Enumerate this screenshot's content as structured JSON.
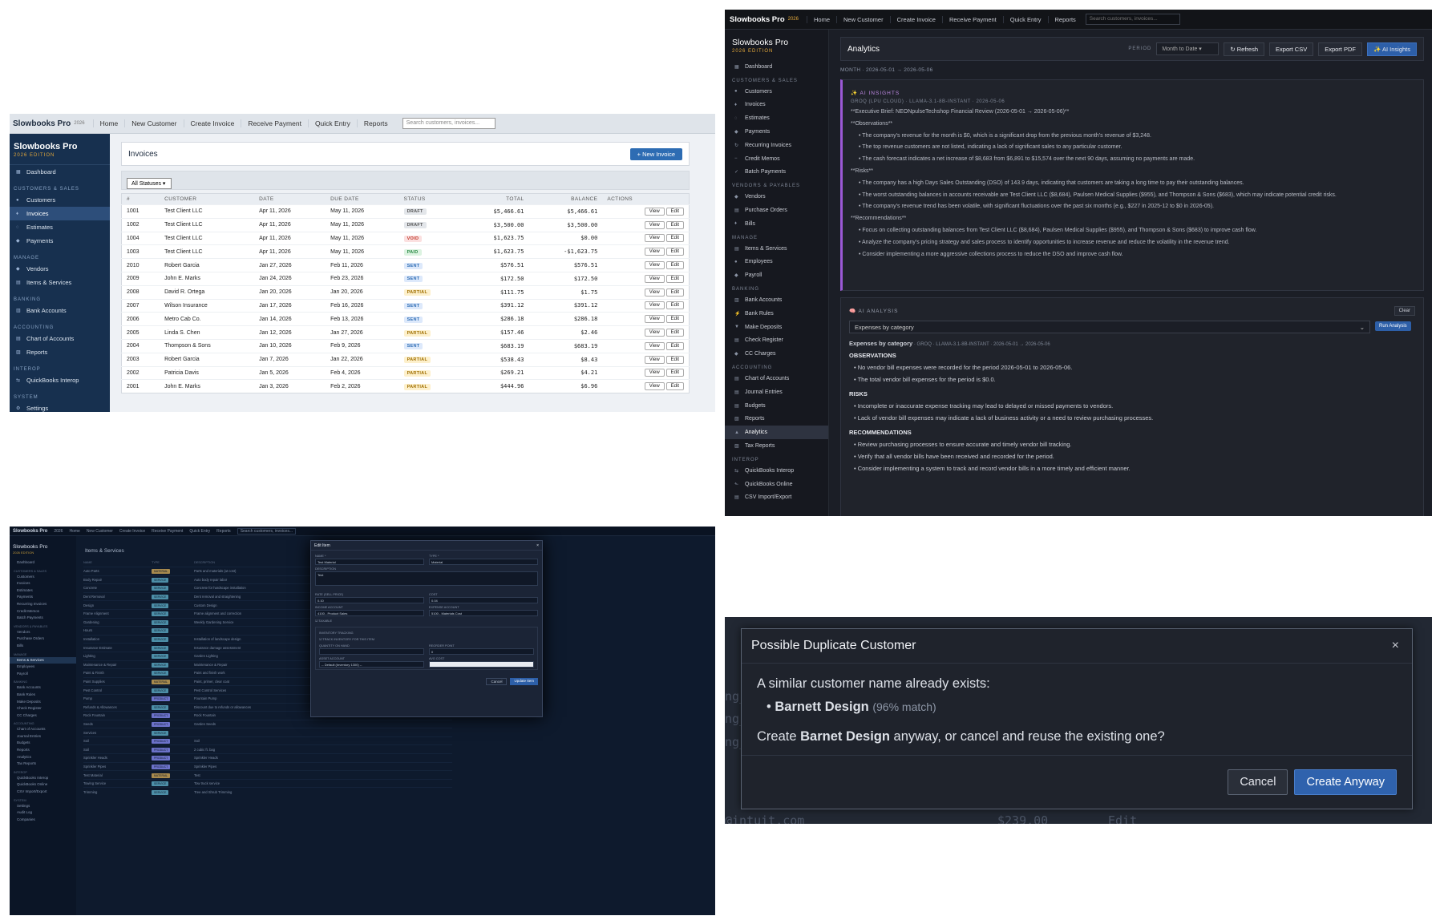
{
  "p1": {
    "brand": "Slowbooks Pro",
    "brand_year": "2026",
    "nav": [
      "Home",
      "New Customer",
      "Create Invoice",
      "Receive Payment",
      "Quick Entry",
      "Reports"
    ],
    "search_placeholder": "Search customers, invoices...",
    "sidebar_title": "Slowbooks Pro",
    "sidebar_edition": "2026 EDITION",
    "sidebar": [
      {
        "section": "",
        "items": [
          {
            "label": "Dashboard",
            "icon": "▦"
          }
        ]
      },
      {
        "section": "CUSTOMERS & SALES",
        "items": [
          {
            "label": "Customers",
            "icon": "●"
          },
          {
            "label": "Invoices",
            "icon": "♦",
            "active": true
          },
          {
            "label": "Estimates",
            "icon": "◌"
          },
          {
            "label": "Payments",
            "icon": "◆"
          }
        ]
      },
      {
        "section": "MANAGE",
        "items": [
          {
            "label": "Vendors",
            "icon": "◆"
          },
          {
            "label": "Items & Services",
            "icon": "▤"
          }
        ]
      },
      {
        "section": "BANKING",
        "items": [
          {
            "label": "Bank Accounts",
            "icon": "▥"
          }
        ]
      },
      {
        "section": "ACCOUNTING",
        "items": [
          {
            "label": "Chart of Accounts",
            "icon": "▤"
          },
          {
            "label": "Reports",
            "icon": "▨"
          }
        ]
      },
      {
        "section": "INTEROP",
        "items": [
          {
            "label": "QuickBooks Interop",
            "icon": "⇆"
          }
        ]
      },
      {
        "section": "SYSTEM",
        "items": [
          {
            "label": "Settings",
            "icon": "⚙"
          }
        ]
      }
    ],
    "page_title": "Invoices",
    "new_button": "+ New Invoice",
    "filter": "All Statuses",
    "columns": [
      "#",
      "CUSTOMER",
      "DATE",
      "DUE DATE",
      "STATUS",
      "TOTAL",
      "BALANCE",
      "ACTIONS"
    ],
    "view_label": "View",
    "edit_label": "Edit",
    "rows": [
      [
        "1001",
        "Test Client LLC",
        "Apr 11, 2026",
        "May 11, 2026",
        "DRAFT",
        "$5,466.61",
        "$5,466.61"
      ],
      [
        "1002",
        "Test Client LLC",
        "Apr 11, 2026",
        "May 11, 2026",
        "DRAFT",
        "$3,500.00",
        "$3,500.00"
      ],
      [
        "1004",
        "Test Client LLC",
        "Apr 11, 2026",
        "May 11, 2026",
        "VOID",
        "$1,623.75",
        "$0.00"
      ],
      [
        "1003",
        "Test Client LLC",
        "Apr 11, 2026",
        "May 11, 2026",
        "PAID",
        "$1,623.75",
        "-$1,623.75"
      ],
      [
        "2010",
        "Robert Garcia",
        "Jan 27, 2026",
        "Feb 11, 2026",
        "SENT",
        "$576.51",
        "$576.51"
      ],
      [
        "2009",
        "John E. Marks",
        "Jan 24, 2026",
        "Feb 23, 2026",
        "SENT",
        "$172.50",
        "$172.50"
      ],
      [
        "2008",
        "David R. Ortega",
        "Jan 20, 2026",
        "Jan 20, 2026",
        "PARTIAL",
        "$111.75",
        "$1.75"
      ],
      [
        "2007",
        "Wilson Insurance",
        "Jan 17, 2026",
        "Feb 16, 2026",
        "SENT",
        "$391.12",
        "$391.12"
      ],
      [
        "2006",
        "Metro Cab Co.",
        "Jan 14, 2026",
        "Feb 13, 2026",
        "SENT",
        "$286.18",
        "$286.18"
      ],
      [
        "2005",
        "Linda S. Chen",
        "Jan 12, 2026",
        "Jan 27, 2026",
        "PARTIAL",
        "$157.46",
        "$2.46"
      ],
      [
        "2004",
        "Thompson & Sons",
        "Jan 10, 2026",
        "Feb 9, 2026",
        "SENT",
        "$683.19",
        "$683.19"
      ],
      [
        "2003",
        "Robert Garcia",
        "Jan 7, 2026",
        "Jan 22, 2026",
        "PARTIAL",
        "$538.43",
        "$8.43"
      ],
      [
        "2002",
        "Patricia Davis",
        "Jan 5, 2026",
        "Feb 4, 2026",
        "PARTIAL",
        "$269.21",
        "$4.21"
      ],
      [
        "2001",
        "John E. Marks",
        "Jan 3, 2026",
        "Feb 2, 2026",
        "PARTIAL",
        "$444.96",
        "$6.96"
      ]
    ]
  },
  "p2": {
    "brand": "Slowbooks Pro",
    "brand_year": "2026",
    "nav": [
      "Home",
      "New Customer",
      "Create Invoice",
      "Receive Payment",
      "Quick Entry",
      "Reports"
    ],
    "search_placeholder": "Search customers, invoices...",
    "sidebar_title": "Slowbooks Pro",
    "sidebar_edition": "2026 EDITION",
    "sidebar": [
      {
        "section": "",
        "items": [
          {
            "label": "Dashboard",
            "icon": "▦"
          }
        ]
      },
      {
        "section": "CUSTOMERS & SALES",
        "items": [
          {
            "label": "Customers",
            "icon": "●"
          },
          {
            "label": "Invoices",
            "icon": "♦"
          },
          {
            "label": "Estimates",
            "icon": "◌"
          },
          {
            "label": "Payments",
            "icon": "◆"
          },
          {
            "label": "Recurring Invoices",
            "icon": "↻"
          },
          {
            "label": "Credit Memos",
            "icon": "−"
          },
          {
            "label": "Batch Payments",
            "icon": "✓"
          }
        ]
      },
      {
        "section": "VENDORS & PAYABLES",
        "items": [
          {
            "label": "Vendors",
            "icon": "◆"
          },
          {
            "label": "Purchase Orders",
            "icon": "▤"
          },
          {
            "label": "Bills",
            "icon": "♦"
          }
        ]
      },
      {
        "section": "MANAGE",
        "items": [
          {
            "label": "Items & Services",
            "icon": "▤"
          },
          {
            "label": "Employees",
            "icon": "●"
          },
          {
            "label": "Payroll",
            "icon": "◆"
          }
        ]
      },
      {
        "section": "BANKING",
        "items": [
          {
            "label": "Bank Accounts",
            "icon": "▥"
          },
          {
            "label": "Bank Rules",
            "icon": "⚡"
          },
          {
            "label": "Make Deposits",
            "icon": "▼"
          },
          {
            "label": "Check Register",
            "icon": "▤"
          },
          {
            "label": "CC Charges",
            "icon": "◆"
          }
        ]
      },
      {
        "section": "ACCOUNTING",
        "items": [
          {
            "label": "Chart of Accounts",
            "icon": "▤"
          },
          {
            "label": "Journal Entries",
            "icon": "▤"
          },
          {
            "label": "Budgets",
            "icon": "▤"
          },
          {
            "label": "Reports",
            "icon": "▨"
          },
          {
            "label": "Analytics",
            "icon": "▲",
            "active": true
          },
          {
            "label": "Tax Reports",
            "icon": "▨"
          }
        ]
      },
      {
        "section": "INTEROP",
        "items": [
          {
            "label": "QuickBooks Interop",
            "icon": "⇆"
          },
          {
            "label": "QuickBooks Online",
            "icon": "⬑"
          },
          {
            "label": "CSV Import/Export",
            "icon": "▤"
          }
        ]
      }
    ],
    "page_title": "Analytics",
    "period_label": "PERIOD",
    "period_value": "Month to Date",
    "refresh": "↻ Refresh",
    "export_csv": "Export CSV",
    "export_pdf": "Export PDF",
    "ai_insights_btn": "✨ AI Insights",
    "range": "MONTH · 2026-05-01 → 2026-05-06",
    "insights_title": "✨ AI INSIGHTS",
    "insights_meta": "GROQ (LPU CLOUD) · LLAMA-3.1-8B-INSTANT · 2026-05-06",
    "insights_lines": [
      {
        "t": "**Executive Brief: NEONpulseTechshop Financial Review (2026-05-01 → 2026-05-06)**",
        "b": false
      },
      {
        "t": "**Observations**",
        "b": false
      },
      {
        "t": "• The company's revenue for the month is $0, which is a significant drop from the previous month's revenue of $3,248.",
        "b": true
      },
      {
        "t": "• The top revenue customers are not listed, indicating a lack of significant sales to any particular customer.",
        "b": true
      },
      {
        "t": "• The cash forecast indicates a net increase of $8,683 from $6,891 to $15,574 over the next 90 days, assuming no payments are made.",
        "b": true
      },
      {
        "t": "**Risks**",
        "b": false
      },
      {
        "t": "• The company has a high Days Sales Outstanding (DSO) of 143.9 days, indicating that customers are taking a long time to pay their outstanding balances.",
        "b": true
      },
      {
        "t": "• The worst outstanding balances in accounts receivable are Test Client LLC ($8,684), Paulsen Medical Supplies ($955), and Thompson & Sons ($683), which may indicate potential credit risks.",
        "b": true
      },
      {
        "t": "• The company's revenue trend has been volatile, with significant fluctuations over the past six months (e.g., $227 in 2025-12 to $0 in 2026-05).",
        "b": true
      },
      {
        "t": "**Recommendations**",
        "b": false
      },
      {
        "t": "• Focus on collecting outstanding balances from Test Client LLC ($8,684), Paulsen Medical Supplies ($955), and Thompson & Sons ($683) to improve cash flow.",
        "b": true
      },
      {
        "t": "• Analyze the company's pricing strategy and sales process to identify opportunities to increase revenue and reduce the volatility in the revenue trend.",
        "b": true
      },
      {
        "t": "• Consider implementing a more aggressive collections process to reduce the DSO and improve cash flow.",
        "b": true
      }
    ],
    "analysis_title": "🧠 AI ANALYSIS",
    "clear": "Clear",
    "analysis_select": "Expenses by category",
    "run_analysis": "Run Analysis",
    "analysis_heading": "Expenses by category",
    "analysis_meta": " · GROQ · LLAMA-3.1-8B-INSTANT · 2026-05-01 → 2026-05-06",
    "obs_h": "OBSERVATIONS",
    "obs": [
      "No vendor bill expenses were recorded for the period 2026-05-01 to 2026-05-06.",
      "The total vendor bill expenses for the period is $0.0."
    ],
    "risks_h": "RISKS",
    "risks": [
      "Incomplete or inaccurate expense tracking may lead to delayed or missed payments to vendors.",
      "Lack of vendor bill expenses may indicate a lack of business activity or a need to review purchasing processes."
    ],
    "rec_h": "RECOMMENDATIONS",
    "recs": [
      "Review purchasing processes to ensure accurate and timely vendor bill tracking.",
      "Verify that all vendor bills have been received and recorded for the period.",
      "Consider implementing a system to track and record vendor bills in a more timely and efficient manner."
    ]
  },
  "p3": {
    "brand": "Slowbooks Pro",
    "brand_year": "2026",
    "nav": [
      "Home",
      "New Customer",
      "Create Invoice",
      "Receive Payment",
      "Quick Entry",
      "Reports"
    ],
    "search_placeholder": "Search customers, invoices...",
    "sidebar_title": "Slowbooks Pro",
    "sidebar_edition": "2026 EDITION",
    "sidebar": [
      {
        "section": "",
        "items": [
          "Dashboard"
        ]
      },
      {
        "section": "CUSTOMERS & SALES",
        "items": [
          "Customers",
          "Invoices",
          "Estimates",
          "Payments",
          "Recurring Invoices",
          "Credit Memos",
          "Batch Payments"
        ]
      },
      {
        "section": "VENDORS & PAYABLES",
        "items": [
          "Vendors",
          "Purchase Orders",
          "Bills"
        ]
      },
      {
        "section": "MANAGE",
        "items": [
          "Items & Services",
          "Employees",
          "Payroll"
        ]
      },
      {
        "section": "BANKING",
        "items": [
          "Bank Accounts",
          "Bank Rules",
          "Make Deposits",
          "Check Register",
          "CC Charges"
        ]
      },
      {
        "section": "ACCOUNTING",
        "items": [
          "Chart of Accounts",
          "Journal Entries",
          "Budgets",
          "Reports",
          "Analytics",
          "Tax Reports"
        ]
      },
      {
        "section": "INTEROP",
        "items": [
          "QuickBooks Interop",
          "QuickBooks Online",
          "CSV Import/Export"
        ]
      },
      {
        "section": "SYSTEM",
        "items": [
          "Settings",
          "Audit Log",
          "Companies"
        ]
      }
    ],
    "active_item": "Items & Services",
    "page_title": "Items & Services",
    "headers": [
      "NAME",
      "TYPE",
      "DESCRIPTION"
    ],
    "items": [
      [
        "Auto Parts",
        "MATERIAL",
        "Parts and materials (at cost)"
      ],
      [
        "Body Repair",
        "SERVICE",
        "Auto body repair labor"
      ],
      [
        "Concrete",
        "SERVICE",
        "Concrete for hardscape installation"
      ],
      [
        "Dent Removal",
        "SERVICE",
        "Dent removal and straightening"
      ],
      [
        "Design",
        "SERVICE",
        "Custom Design"
      ],
      [
        "Frame Alignment",
        "SERVICE",
        "Frame alignment and correction"
      ],
      [
        "Gardening",
        "SERVICE",
        "Weekly Gardening Service"
      ],
      [
        "Hours",
        "SERVICE",
        ""
      ],
      [
        "Installation",
        "SERVICE",
        "Installation of landscape design"
      ],
      [
        "Insurance Estimate",
        "SERVICE",
        "Insurance damage assessment"
      ],
      [
        "Lighting",
        "SERVICE",
        "Garden Lighting"
      ],
      [
        "Maintenance & Repair",
        "SERVICE",
        "Maintenance & Repair"
      ],
      [
        "Paint & Finish",
        "SERVICE",
        "Paint and finish work"
      ],
      [
        "Paint Supplies",
        "MATERIAL",
        "Paint, primer, clear coat"
      ],
      [
        "Pest Control",
        "SERVICE",
        "Pest Control Services"
      ],
      [
        "Pump",
        "PRODUCT",
        "Fountain Pump"
      ],
      [
        "Refunds & Allowances",
        "SERVICE",
        "Discount due to refunds or allowances"
      ],
      [
        "Rock Fountain",
        "PRODUCT",
        "Rock Fountain"
      ],
      [
        "Seeds",
        "PRODUCT",
        "Garden Seeds"
      ],
      [
        "Services",
        "SERVICE",
        ""
      ],
      [
        "Soil",
        "PRODUCT",
        "Soil"
      ],
      [
        "Soil",
        "PRODUCT",
        "2 cubic ft. bag"
      ],
      [
        "Sprinkler Heads",
        "PRODUCT",
        "Sprinkler Heads"
      ],
      [
        "Sprinkler Pipes",
        "PRODUCT",
        "Sprinkler Pipes"
      ],
      [
        "Test Material",
        "MATERIAL",
        "Test"
      ],
      [
        "Towing Service",
        "SERVICE",
        "Tow truck service"
      ],
      [
        "Trimming",
        "SERVICE",
        "Tree and Shrub Trimming"
      ]
    ],
    "modal": {
      "title": "Edit Item",
      "close": "×",
      "name_label": "NAME *",
      "name_value": "Test Material",
      "type_label": "TYPE *",
      "type_value": "Material",
      "desc_label": "DESCRIPTION",
      "desc_value": "Test",
      "rate_label": "RATE (SELL PRICE)",
      "rate_value": "0.10",
      "cost_label": "COST",
      "cost_value": "0.04",
      "income_label": "INCOME ACCOUNT",
      "income_value": "4100 - Product Sales",
      "expense_label": "EXPENSE ACCOUNT",
      "expense_value": "5100 - Materials Cost",
      "taxable": "TAXABLE",
      "inv_label": "INVENTORY TRACKING",
      "track": "TRACK INVENTORY FOR THIS ITEM",
      "qty_label": "QUANTITY ON HAND",
      "reorder_label": "REORDER POINT",
      "reorder_value": "0",
      "asset_label": "ASSET ACCOUNT",
      "asset_value": "-- Default (Inventory 1300) --",
      "avg_label": "AVG COST",
      "cancel": "Cancel",
      "update": "Update Item"
    }
  },
  "p4": {
    "bg_lines": [
      "ng_",
      "ng_",
      "ng_",
      "@intuit.com",
      "$239.00",
      "Edit"
    ],
    "title": "Possible Duplicate Customer",
    "close": "×",
    "msg": "A similar customer name already exists:",
    "match_name": "Barnett Design",
    "match_pct": "(96% match)",
    "q_pre": "Create ",
    "q_name": "Barnet Design",
    "q_post": " anyway, or cancel and reuse the existing one?",
    "cancel": "Cancel",
    "create": "Create Anyway"
  }
}
